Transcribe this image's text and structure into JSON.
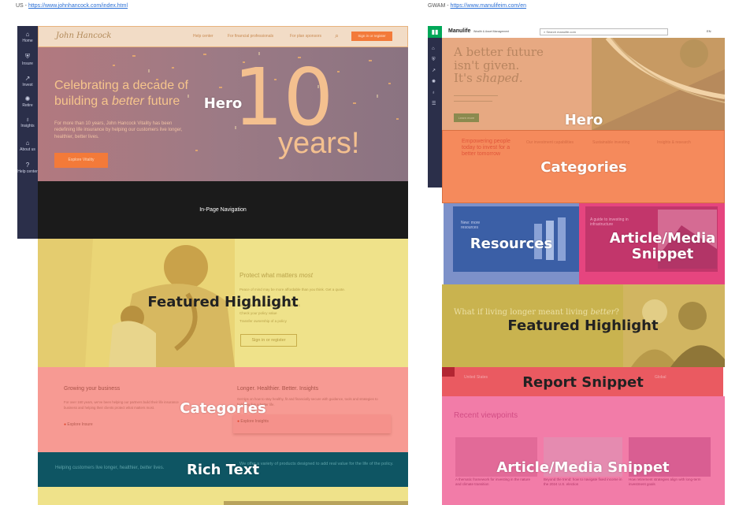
{
  "left": {
    "caption": "US - ",
    "url": "https://www.johnhancock.com/index.html",
    "sidebar": [
      {
        "label": "Home",
        "icon": "home-icon",
        "glyph": "⌂"
      },
      {
        "label": "Insure",
        "icon": "shield-icon",
        "glyph": "⛨"
      },
      {
        "label": "Invest",
        "icon": "chart-icon",
        "glyph": "↗"
      },
      {
        "label": "Retire",
        "icon": "sun-icon",
        "glyph": "✺"
      },
      {
        "label": "Insights",
        "icon": "bulb-icon",
        "glyph": "♁"
      },
      {
        "label": "About us",
        "icon": "building-icon",
        "glyph": "⌂"
      },
      {
        "label": "Help center",
        "icon": "help-icon",
        "glyph": "?"
      }
    ],
    "header": {
      "logo": "John Hancock",
      "nav": [
        "Help center",
        "For financial professionals",
        "For plan sponsors"
      ],
      "cta": "Sign in or register"
    },
    "hero": {
      "title_a": "Celebrating a decade of",
      "title_b": "building a ",
      "title_em": "better",
      "title_c": " future",
      "big_number": "10",
      "big_word": "years!",
      "body": "For more than 10 years, John Hancock Vitality has been redefining life insurance by helping our customers live longer, healthier, better lives.",
      "button": "Explore Vitality"
    },
    "inpage_nav": "In-Page Navigation",
    "featured": {
      "title": "Protect what matters ",
      "title_em": "most",
      "lines": [
        "Peace of mind may be more affordable than you think. Get a quote.",
        "Manage payments & address changes",
        "Check your policy value",
        "Transfer ownership of a policy"
      ],
      "button": "Sign in or register"
    },
    "categories": {
      "col1_title": "Growing your business",
      "col1_body": "For over 160 years, we've been helping our partners build their life insurance business and helping their clients protect what matters most.",
      "col1_link": "Explore Insure",
      "col2_title": "Longer. Healthier. Better. Insights",
      "col2_body": "Get tips on how to stay healthy, fit and financially secure with guidance, tools and strategies to help you live a better life.",
      "col2_link": "Explore Insights"
    },
    "richtext": {
      "left": "Helping customers live longer, healthier, ",
      "left_em": "better",
      "left_end": " lives.",
      "right": "We offer a variety of products designed to add real value for the life of the policy."
    },
    "overlays": {
      "hero": "Hero",
      "featured": "Featured Highlight",
      "categories": "Categories",
      "richtext": "Rich Text"
    },
    "colors": {
      "hero": "#8a6f78",
      "hero_overlay": "#b07b7e",
      "sidebar": "#2b2f4a",
      "inpage": "#1b1b1b",
      "featured": "#efe28a",
      "categories": "#f79a93",
      "richtext": "#0e5563",
      "accent": "#f37a39"
    }
  },
  "right": {
    "caption": "GWAM - ",
    "url": "https://www.manulifeim.com/en",
    "header": {
      "logo": "Manulife",
      "sub": "Wealth & Asset Management",
      "search": "Search manulife.com",
      "lang": "EN"
    },
    "hero": {
      "title_a": "A better future",
      "title_b": "isn't given.",
      "title_c": "It's ",
      "title_em": "shaped.",
      "button": "Learn more"
    },
    "categories": {
      "lead": "Empowering people today to invest for a better tomorrow",
      "cols": [
        "Our investment capabilities",
        "Sustainable investing",
        "Insights & research"
      ]
    },
    "resources": {
      "text": "New: more resources"
    },
    "article_top": {
      "text": "A guide to investing in infrastructure"
    },
    "featured": {
      "title": "What if living longer meant living ",
      "title_em": "better",
      "title_end": "?"
    },
    "report": {
      "left": "United States",
      "right": "Global"
    },
    "recent": {
      "title": "Recent viewpoints",
      "items": [
        "A thematic framework for investing in the nature and climate transition",
        "Beyond the trend: how to navigate fixed income in the 2024 U.S. election",
        "How retirement strategies align with long-term investment goals"
      ]
    },
    "overlays": {
      "hero": "Hero",
      "categories": "Categories",
      "resources": "Resources",
      "article_top": "Article/Media\nSnippet",
      "featured": "Featured Highlight",
      "report": "Report Snippet",
      "article_bottom": "Article/Media Snippet"
    },
    "colors": {
      "hero": "#d4a78a",
      "hero_overlay": "#e7a982",
      "categories": "#f58a5c",
      "resources": "#7d91c9",
      "article_top": "#e6457f",
      "featured": "#c9b34f",
      "report": "#ea5a61",
      "article_bottom": "#f27ca8",
      "brand": "#00a758"
    }
  }
}
